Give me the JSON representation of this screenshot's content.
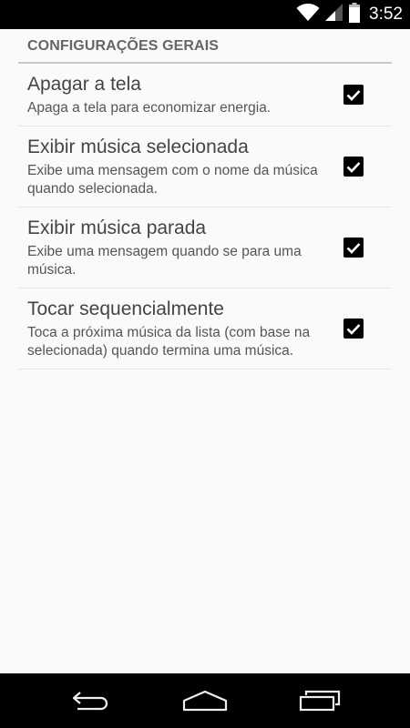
{
  "status_bar": {
    "time": "3:52",
    "icons": [
      "wifi-icon",
      "signal-icon",
      "battery-icon"
    ]
  },
  "settings": {
    "section_title": "CONFIGURAÇÕES GERAIS",
    "items": [
      {
        "title": "Apagar a tela",
        "summary": "Apaga a tela para economizar energia.",
        "checked": true
      },
      {
        "title": "Exibir música selecionada",
        "summary": "Exibe uma mensagem com o nome da música quando selecionada.",
        "checked": true
      },
      {
        "title": "Exibir música parada",
        "summary": "Exibe uma mensagem quando se para uma música.",
        "checked": true
      },
      {
        "title": "Tocar sequencialmente",
        "summary": "Toca a próxima música da lista (com base na selecionada) quando termina uma música.",
        "checked": true
      }
    ]
  },
  "nav_bar": {
    "buttons": [
      "back-icon",
      "home-icon",
      "recents-icon"
    ]
  },
  "colors": {
    "background": "#fafafa",
    "bars": "#000000",
    "title_text": "#444444",
    "summary_text": "#555555",
    "divider": "#c8c8c8"
  }
}
